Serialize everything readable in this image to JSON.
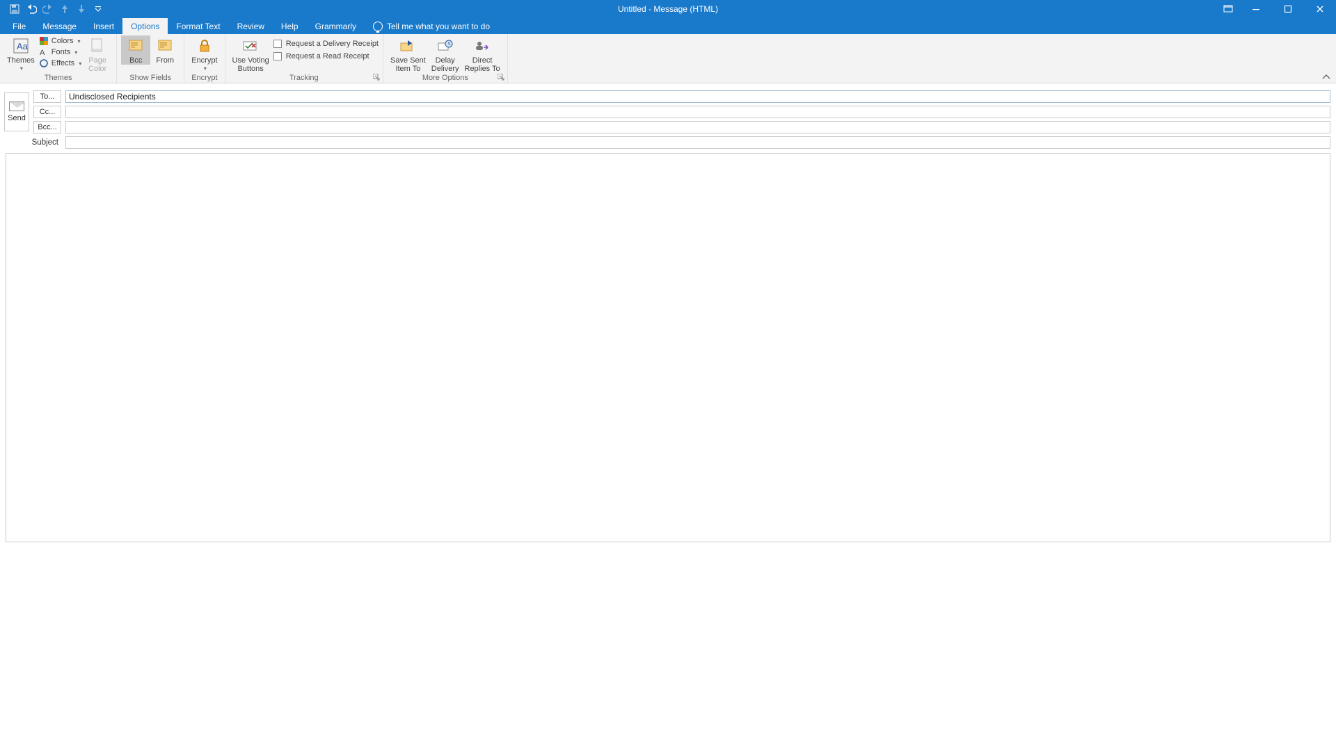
{
  "window": {
    "title": "Untitled  -  Message (HTML)"
  },
  "tabs": {
    "file": "File",
    "message": "Message",
    "insert": "Insert",
    "options": "Options",
    "format_text": "Format Text",
    "review": "Review",
    "help": "Help",
    "grammarly": "Grammarly",
    "tell_me": "Tell me what you want to do"
  },
  "ribbon": {
    "themes": {
      "label": "Themes",
      "themes_btn": "Themes",
      "colors": "Colors",
      "fonts": "Fonts",
      "effects": "Effects",
      "page_color": "Page\nColor"
    },
    "show_fields": {
      "label": "Show Fields",
      "bcc": "Bcc",
      "from": "From"
    },
    "encrypt": {
      "label": "Encrypt",
      "btn": "Encrypt"
    },
    "tracking": {
      "label": "Tracking",
      "voting": "Use Voting\nButtons",
      "delivery": "Request a Delivery Receipt",
      "read": "Request a Read Receipt"
    },
    "more": {
      "label": "More Options",
      "save_sent": "Save Sent\nItem To",
      "delay": "Delay\nDelivery",
      "direct": "Direct\nReplies To"
    }
  },
  "compose": {
    "send": "Send",
    "to_btn": "To...",
    "cc_btn": "Cc...",
    "bcc_btn": "Bcc...",
    "subject_label": "Subject",
    "to_value": "Undisclosed Recipients",
    "cc_value": "",
    "bcc_value": "",
    "subject_value": ""
  }
}
